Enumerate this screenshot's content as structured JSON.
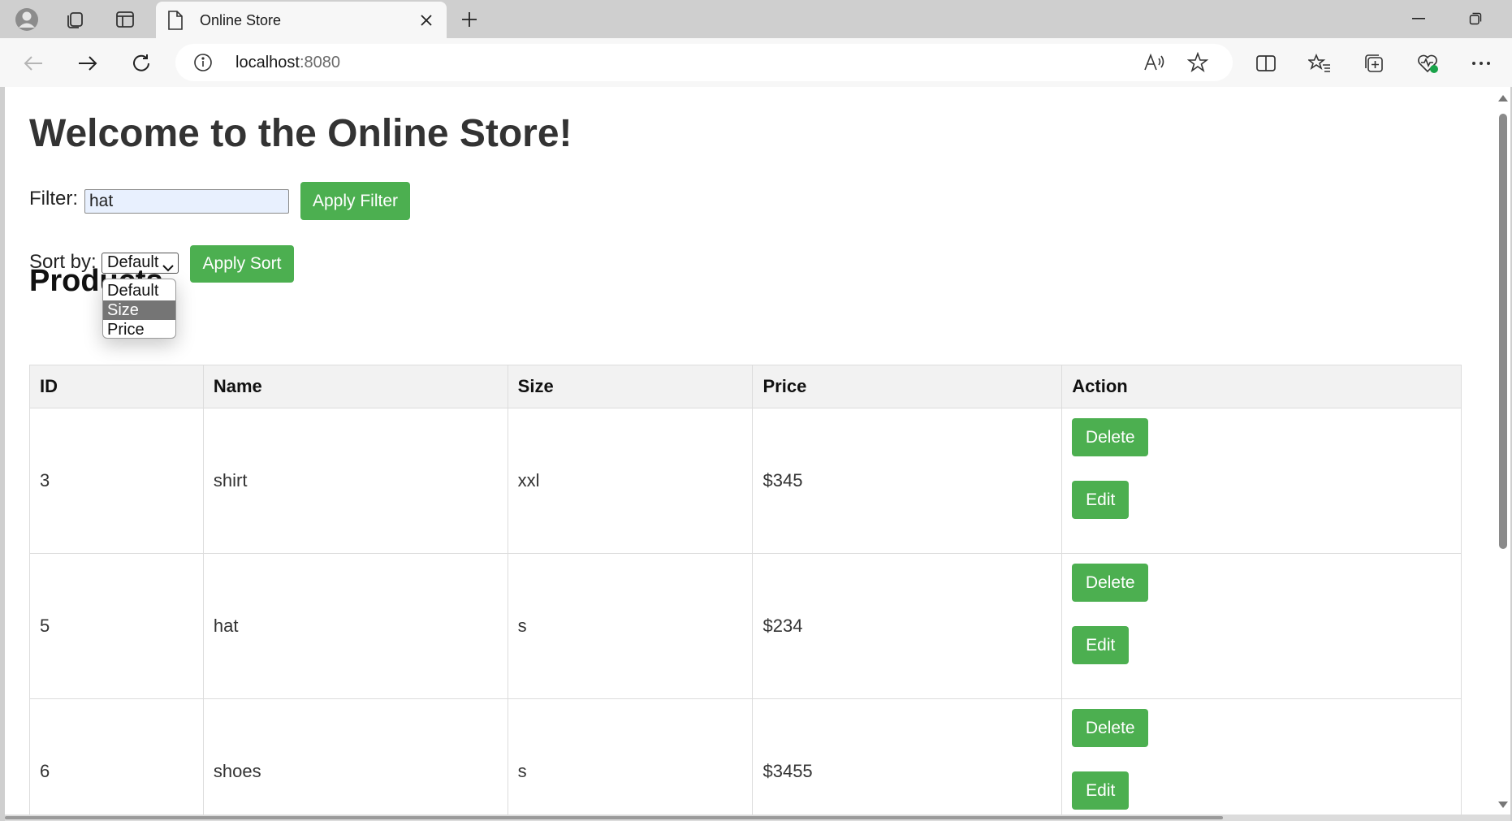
{
  "browser": {
    "tab_title": "Online Store",
    "address_host": "localhost",
    "address_port": ":8080"
  },
  "page": {
    "heading": "Welcome to the Online Store!",
    "filter_label": "Filter:",
    "filter_value": "hat",
    "apply_filter_label": "Apply Filter",
    "sort_label": "Sort by:",
    "sort_selected": "Default",
    "sort_options": [
      "Default",
      "Size",
      "Price"
    ],
    "sort_highlighted": "Size",
    "apply_sort_label": "Apply Sort",
    "section_heading": "Products"
  },
  "table": {
    "headers": [
      "ID",
      "Name",
      "Size",
      "Price",
      "Action"
    ],
    "rows": [
      {
        "id": "3",
        "name": "shirt",
        "size": "xxl",
        "price": "$345"
      },
      {
        "id": "5",
        "name": "hat",
        "size": "s",
        "price": "$234"
      },
      {
        "id": "6",
        "name": "shoes",
        "size": "s",
        "price": "$3455"
      }
    ],
    "delete_label": "Delete",
    "edit_label": "Edit"
  },
  "colors": {
    "accent_green": "#4caf50",
    "header_bg": "#f2f2f2",
    "autofill_bg": "#e8f0fe"
  }
}
